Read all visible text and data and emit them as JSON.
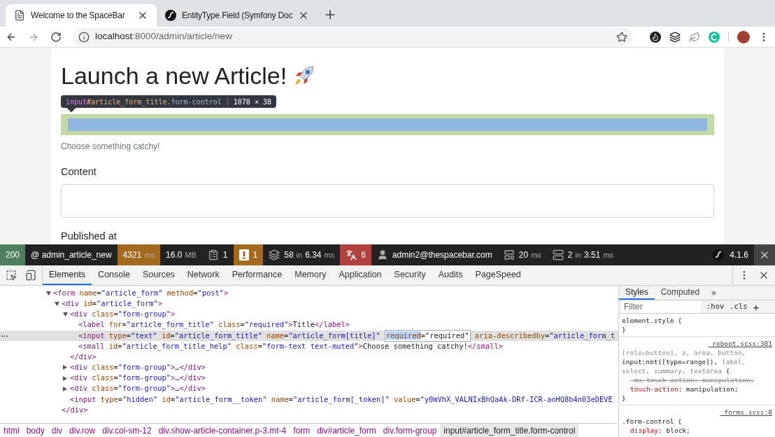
{
  "browser": {
    "tabs": [
      {
        "title": "Welcome to the SpaceBar",
        "kind": "page",
        "selected": true
      },
      {
        "title": "EntityType Field (Symfony Doc",
        "kind": "symfony",
        "selected": false
      }
    ],
    "address": {
      "host": "localhost",
      "path": ":8000/admin/article/new"
    }
  },
  "page": {
    "heading": "Launch a new Article!",
    "inspect_tooltip": {
      "tag": "input",
      "id": "#article_form_title",
      "cls": ".form-control",
      "size": "1078 × 38"
    },
    "help": "Choose something catchy!",
    "content_label": "Content",
    "published_label": "Published at"
  },
  "profiler": {
    "items": [
      {
        "kind": "status",
        "parts": [
          {
            "value": "200"
          }
        ],
        "color": "#4f805d"
      },
      {
        "kind": "route",
        "parts": [
          {
            "value": "@ admin_article_new"
          }
        ],
        "color": "#222222"
      },
      {
        "kind": "time",
        "parts": [
          {
            "value": "4321"
          },
          {
            "unit": "ms"
          }
        ],
        "color": "#a46a1f"
      },
      {
        "kind": "memory",
        "parts": [
          {
            "value": "16.0"
          },
          {
            "unit": "MB"
          }
        ],
        "color": "#222222"
      },
      {
        "kind": "forms",
        "parts": [
          {
            "value": "1"
          }
        ],
        "color": "#222222"
      },
      {
        "kind": "warning",
        "parts": [
          {
            "value": "1"
          }
        ],
        "color": "#a46a1f"
      },
      {
        "kind": "layers",
        "parts": [
          {
            "value": "58"
          },
          {
            "unit": "in"
          },
          {
            "value": "6.34"
          },
          {
            "unit": "ms"
          }
        ],
        "color": "#222222"
      },
      {
        "kind": "translation",
        "parts": [
          {
            "value": "6"
          }
        ],
        "color": "#b0413e"
      },
      {
        "kind": "user",
        "parts": [
          {
            "value": "admin2@thespacebar.com"
          }
        ],
        "color": "#222222"
      },
      {
        "kind": "twig",
        "parts": [
          {
            "value": "20"
          },
          {
            "unit": "ms"
          }
        ],
        "color": "#222222"
      },
      {
        "kind": "database",
        "parts": [
          {
            "value": "2"
          },
          {
            "unit": "in"
          },
          {
            "value": "3.51"
          },
          {
            "unit": "ms"
          }
        ],
        "color": "#222222"
      }
    ],
    "version": "4.1.6"
  },
  "devtools": {
    "tabs": [
      {
        "label": "Elements",
        "selected": true
      },
      {
        "label": "Console",
        "selected": false
      },
      {
        "label": "Sources",
        "selected": false
      },
      {
        "label": "Network",
        "selected": false
      },
      {
        "label": "Performance",
        "selected": false
      },
      {
        "label": "Memory",
        "selected": false
      },
      {
        "label": "Application",
        "selected": false
      },
      {
        "label": "Security",
        "selected": false
      },
      {
        "label": "Audits",
        "selected": false
      },
      {
        "label": "PageSpeed",
        "selected": false
      }
    ],
    "tree": [
      {
        "expanded": true,
        "selected": false,
        "tokens": [
          {
            "tag": "<form"
          },
          {
            "attr": " name"
          },
          {
            "p": "="
          },
          {
            "val": "\"article_form\""
          },
          {
            "attr": " method"
          },
          {
            "p": "="
          },
          {
            "val": "\"post\""
          },
          {
            "tag": ">"
          }
        ],
        "children": [
          {
            "expanded": true,
            "selected": false,
            "tokens": [
              {
                "tag": "<div"
              },
              {
                "attr": " id"
              },
              {
                "p": "="
              },
              {
                "val": "\"article_form\""
              },
              {
                "tag": ">"
              }
            ],
            "close": [
              {
                "tag": "</div>"
              }
            ],
            "children": [
              {
                "expanded": true,
                "selected": false,
                "tokens": [
                  {
                    "tag": "<div"
                  },
                  {
                    "attr": " class"
                  },
                  {
                    "p": "="
                  },
                  {
                    "val": "\"form-group\""
                  },
                  {
                    "tag": ">"
                  }
                ],
                "close": [
                  {
                    "tag": "</div>"
                  }
                ],
                "children": [
                  {
                    "selected": false,
                    "tokens": [
                      {
                        "tag": "<label"
                      },
                      {
                        "attr": " for"
                      },
                      {
                        "p": "="
                      },
                      {
                        "val": "\"article_form_title\""
                      },
                      {
                        "attr": " class"
                      },
                      {
                        "p": "="
                      },
                      {
                        "val": "\"required\""
                      },
                      {
                        "tag": ">"
                      },
                      {
                        "text": "Title"
                      },
                      {
                        "tag": "</label>"
                      }
                    ]
                  },
                  {
                    "selected": true,
                    "tokens": [
                      {
                        "tag": "<input"
                      },
                      {
                        "attr": " type"
                      },
                      {
                        "p": "="
                      },
                      {
                        "val": "\"text\""
                      },
                      {
                        "attr": " id"
                      },
                      {
                        "p": "="
                      },
                      {
                        "val": "\"article_form_title\""
                      },
                      {
                        "attr": " name"
                      },
                      {
                        "p": "="
                      },
                      {
                        "val": "\"article_form[title]\""
                      },
                      {
                        "edit": "required",
                        "edit_rest": "=\"required\""
                      },
                      {
                        "attr": " aria-describedby"
                      },
                      {
                        "p": "="
                      },
                      {
                        "val": "\"article_form_t"
                      }
                    ]
                  },
                  {
                    "selected": false,
                    "tokens": [
                      {
                        "tag": "<small"
                      },
                      {
                        "attr": " id"
                      },
                      {
                        "p": "="
                      },
                      {
                        "val": "\"article_form_title_help\""
                      },
                      {
                        "attr": " class"
                      },
                      {
                        "p": "="
                      },
                      {
                        "val": "\"form-text text-muted\""
                      },
                      {
                        "tag": ">"
                      },
                      {
                        "text": "Choose something catchy!"
                      },
                      {
                        "tag": "</small>"
                      }
                    ]
                  }
                ]
              },
              {
                "expanded": false,
                "selected": false,
                "tokens": [
                  {
                    "tag": "<div"
                  },
                  {
                    "attr": " class"
                  },
                  {
                    "p": "="
                  },
                  {
                    "val": "\"form-group\""
                  },
                  {
                    "tag": ">"
                  },
                  {
                    "text": "…"
                  },
                  {
                    "tag": "</div>"
                  }
                ]
              },
              {
                "expanded": false,
                "selected": false,
                "tokens": [
                  {
                    "tag": "<div"
                  },
                  {
                    "attr": " class"
                  },
                  {
                    "p": "="
                  },
                  {
                    "val": "\"form-group\""
                  },
                  {
                    "tag": ">"
                  },
                  {
                    "text": "…"
                  },
                  {
                    "tag": "</div>"
                  }
                ]
              },
              {
                "expanded": false,
                "selected": false,
                "tokens": [
                  {
                    "tag": "<div"
                  },
                  {
                    "attr": " class"
                  },
                  {
                    "p": "="
                  },
                  {
                    "val": "\"form-group\""
                  },
                  {
                    "tag": ">"
                  },
                  {
                    "text": "…"
                  },
                  {
                    "tag": "</div>"
                  }
                ]
              },
              {
                "selected": false,
                "tokens": [
                  {
                    "tag": "<input"
                  },
                  {
                    "attr": " type"
                  },
                  {
                    "p": "="
                  },
                  {
                    "val": "\"hidden\""
                  },
                  {
                    "attr": " id"
                  },
                  {
                    "p": "="
                  },
                  {
                    "val": "\"article_form__token\""
                  },
                  {
                    "attr": " name"
                  },
                  {
                    "p": "="
                  },
                  {
                    "val": "\"article_form[_token]\""
                  },
                  {
                    "attr": " value"
                  },
                  {
                    "p": "="
                  },
                  {
                    "val": "\"y0mVhX_VALNIxBhQaAk-DRf-ICR-aoHQ8b4n03eDEVE"
                  }
                ]
              }
            ]
          }
        ]
      }
    ],
    "breadcrumbs": [
      {
        "label": "html",
        "selected": false
      },
      {
        "label": "body",
        "selected": false
      },
      {
        "label": "div",
        "selected": false
      },
      {
        "label": "div.row",
        "selected": false
      },
      {
        "label": "div.col-sm-12",
        "selected": false
      },
      {
        "label": "div.show-article-container.p-3.mt-4",
        "selected": false
      },
      {
        "label": "form",
        "selected": false
      },
      {
        "label": "div#article_form",
        "selected": false
      },
      {
        "label": "div.form-group",
        "selected": false
      },
      {
        "label": "input#article_form_title.form-control",
        "selected": true
      }
    ],
    "side_tabs": [
      {
        "label": "Styles",
        "selected": true
      },
      {
        "label": "Computed",
        "selected": false
      }
    ],
    "more": "»",
    "filter": {
      "placeholder": "Filter"
    },
    "hov": ":hov",
    "cls": ".cls",
    "add": "+",
    "rules": [
      {
        "selector": [
          {
            "matched": "element.style"
          }
        ],
        "open": "{",
        "close": "}"
      },
      {
        "source": "_reboot.scss:301",
        "selector": [
          {
            "other": "[role=button],"
          },
          {
            "other": "a,"
          },
          {
            "other": "area,"
          },
          {
            "other": "button,"
          },
          {
            "matched": "input:not([type=range]),"
          },
          {
            "other": "label,"
          },
          {
            "other": "select,"
          },
          {
            "other": "summary,"
          },
          {
            "other": "textarea"
          }
        ],
        "open": "{",
        "decls": [
          {
            "prop": "-ms-touch-action",
            "rest": ": manipulation;",
            "struck": true
          },
          {
            "prop": "touch-action",
            "rest": ": manipulation;",
            "struck": false
          }
        ],
        "close": "}"
      },
      {
        "source": "_forms.scss:8",
        "selector": [
          {
            "matched": ".form-control"
          }
        ],
        "open": "{",
        "decls": [
          {
            "prop": "display",
            "rest": ": block;",
            "struck": false
          }
        ]
      }
    ]
  }
}
